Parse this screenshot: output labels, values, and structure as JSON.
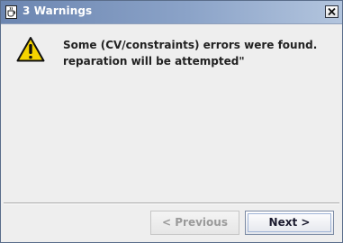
{
  "window": {
    "title": "3 Warnings",
    "icon": "java-cup-icon",
    "close_icon": "close-icon"
  },
  "dialog": {
    "icon": "warning-icon",
    "message_line1": "Some (CV/constraints) errors were found.",
    "message_line2": "reparation will be attempted\""
  },
  "buttons": {
    "previous_label": "< Previous",
    "previous_enabled": false,
    "next_label": "Next >",
    "next_enabled": true
  },
  "colors": {
    "titlebar_start": "#6c86b1",
    "titlebar_end": "#b3c5de",
    "warning_fill": "#f5d400",
    "background": "#eeeeee"
  }
}
